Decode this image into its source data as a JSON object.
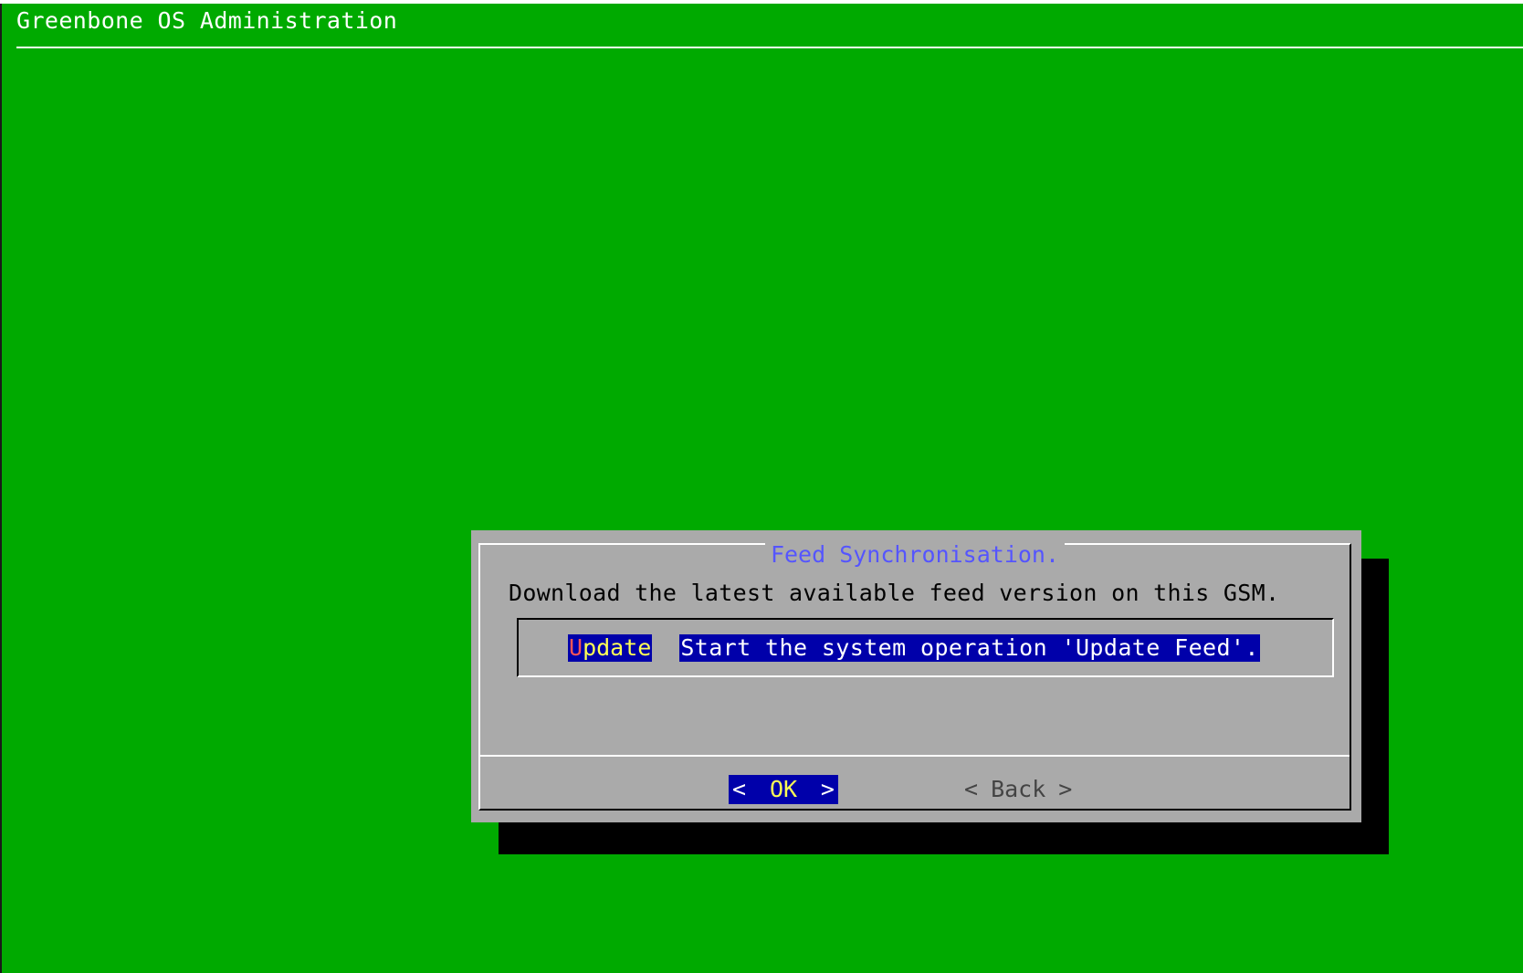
{
  "backtitle": "Greenbone OS Administration",
  "dialog": {
    "title": "Feed Synchronisation.",
    "prompt": "Download the latest available feed version on this GSM.",
    "menu_items": [
      {
        "tag_hotkey": "U",
        "tag_rest": "pdate",
        "description": "Start the system operation 'Update Feed'."
      }
    ],
    "buttons": {
      "ok": {
        "left": "<",
        "label": "OK",
        "right": ">"
      },
      "back": {
        "left": "<",
        "label": "Back",
        "right": ">"
      }
    }
  },
  "colors": {
    "desktop": "#00aa00",
    "dialog": "#aaaaaa",
    "title_text": "#5555ff",
    "selection": "#0000aa",
    "tag_text": "#ffff55",
    "hotkey": "#ff5555"
  }
}
